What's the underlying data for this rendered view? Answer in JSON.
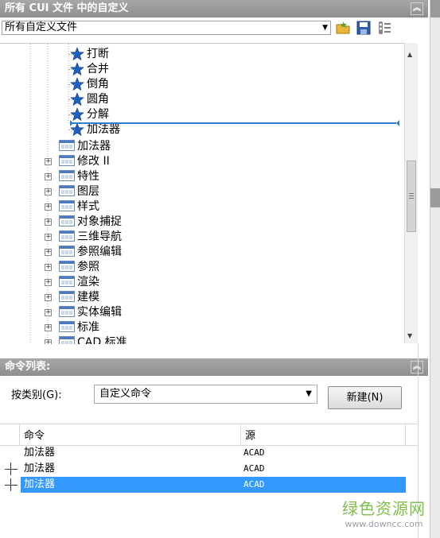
{
  "top_panel": {
    "title": "所有 CUI 文件 中的自定义",
    "collapse_glyph": "︽",
    "file_combo_value": "所有自定义文件",
    "combo_arrow": "▼"
  },
  "tree": {
    "commands": [
      {
        "label": "打断",
        "icon": "star-icon"
      },
      {
        "label": "合并",
        "icon": "star-icon"
      },
      {
        "label": "倒角",
        "icon": "star-icon"
      },
      {
        "label": "圆角",
        "icon": "star-icon"
      },
      {
        "label": "分解",
        "icon": "star-icon"
      },
      {
        "label": "加法器",
        "icon": "star-icon"
      }
    ],
    "toolbars": [
      {
        "label": "加法器",
        "expandable": false
      },
      {
        "label": "修改 II",
        "expandable": true
      },
      {
        "label": "特性",
        "expandable": true
      },
      {
        "label": "图层",
        "expandable": true
      },
      {
        "label": "样式",
        "expandable": true
      },
      {
        "label": "对象捕捉",
        "expandable": true
      },
      {
        "label": "三维导航",
        "expandable": true
      },
      {
        "label": "参照编辑",
        "expandable": true
      },
      {
        "label": "参照",
        "expandable": true
      },
      {
        "label": "渲染",
        "expandable": true
      },
      {
        "label": "建模",
        "expandable": true
      },
      {
        "label": "实体编辑",
        "expandable": true
      },
      {
        "label": "标准",
        "expandable": true
      },
      {
        "label": "CAD 标准",
        "expandable": true
      }
    ]
  },
  "command_panel": {
    "title": "命令列表:",
    "collapse_glyph": "︽",
    "category_label": "按类别(G):",
    "category_value": "自定义命令",
    "combo_arrow": "▼",
    "new_button": "新建(N)"
  },
  "table": {
    "columns": [
      "命令",
      "源"
    ],
    "rows": [
      {
        "command": "加法器",
        "source": "ACAD",
        "selected": false
      },
      {
        "command": "加法器",
        "source": "ACAD",
        "selected": false
      },
      {
        "command": "加法器",
        "source": "ACAD",
        "selected": true
      }
    ]
  },
  "watermark": {
    "brand": "绿色资源网",
    "url": "www.downcc.com"
  },
  "colors": {
    "header_bg": "#9b9b9b",
    "selection": "#3399ff",
    "star": "#1f5fbf",
    "drag_line": "#2a7fd0",
    "watermark": "#7cc04a"
  }
}
